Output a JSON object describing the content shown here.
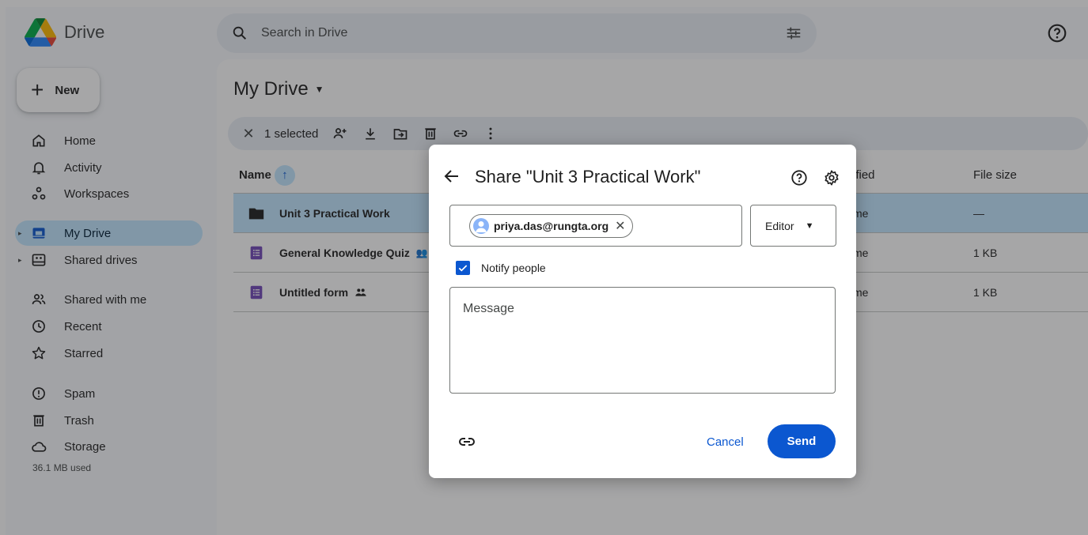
{
  "app": {
    "title": "Drive"
  },
  "search": {
    "placeholder": "Search in Drive"
  },
  "sidebar": {
    "new_label": "New",
    "items": [
      {
        "label": "Home",
        "icon": "home-icon"
      },
      {
        "label": "Activity",
        "icon": "bell-icon"
      },
      {
        "label": "Workspaces",
        "icon": "workspaces-icon"
      },
      {
        "label": "My Drive",
        "icon": "my-drive-icon",
        "active": true
      },
      {
        "label": "Shared drives",
        "icon": "shared-drives-icon"
      },
      {
        "label": "Shared with me",
        "icon": "people-icon"
      },
      {
        "label": "Recent",
        "icon": "clock-icon"
      },
      {
        "label": "Starred",
        "icon": "star-icon"
      },
      {
        "label": "Spam",
        "icon": "spam-icon"
      },
      {
        "label": "Trash",
        "icon": "trash-icon"
      },
      {
        "label": "Storage",
        "icon": "cloud-icon"
      }
    ],
    "storage_used": "36.1 MB used"
  },
  "main": {
    "title": "My Drive",
    "toolbar": {
      "selected_label": "1 selected"
    },
    "table": {
      "headers": {
        "name": "Name",
        "modified": "ified",
        "size": "File size"
      },
      "rows": [
        {
          "name": "Unit 3 Practical Work",
          "type": "folder",
          "modified": "me",
          "size": "—",
          "selected": true
        },
        {
          "name": "General Knowledge Quiz",
          "type": "form",
          "shared": true,
          "modified": "me",
          "size": "1 KB"
        },
        {
          "name": "Untitled form",
          "type": "form",
          "shared": true,
          "modified": "me",
          "size": "1 KB"
        }
      ]
    }
  },
  "dialog": {
    "title": "Share \"Unit 3 Practical Work\"",
    "recipient": "priya.das@rungta.org",
    "role": "Editor",
    "notify_label": "Notify people",
    "notify_checked": true,
    "message_placeholder": "Message",
    "cancel_label": "Cancel",
    "send_label": "Send"
  },
  "colors": {
    "accent": "#0b57d0",
    "selection": "#c2e7ff",
    "surface": "#f8fafd"
  }
}
